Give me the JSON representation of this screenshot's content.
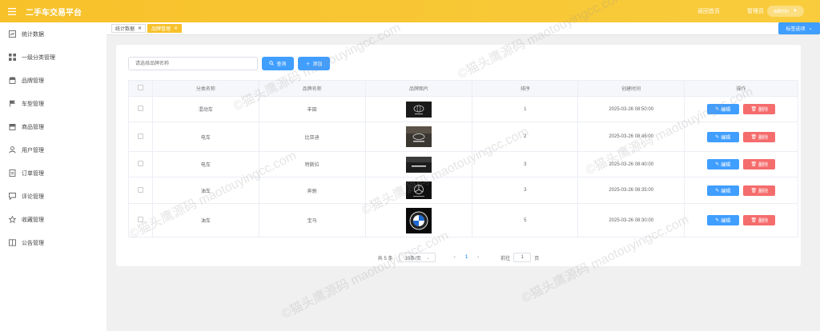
{
  "header": {
    "title": "二手车交易平台",
    "home_link": "返回首页",
    "user_role": "管理员",
    "username": "admin"
  },
  "sidebar": {
    "items": [
      {
        "label": "统计数据",
        "icon": "chart-icon"
      },
      {
        "label": "一级分类管理",
        "icon": "grid-icon"
      },
      {
        "label": "品牌管理",
        "icon": "store-icon"
      },
      {
        "label": "车型管理",
        "icon": "flag-icon"
      },
      {
        "label": "商品管理",
        "icon": "goods-icon"
      },
      {
        "label": "用户管理",
        "icon": "user-icon"
      },
      {
        "label": "订单管理",
        "icon": "document-icon"
      },
      {
        "label": "评论管理",
        "icon": "comment-icon"
      },
      {
        "label": "收藏管理",
        "icon": "star-icon"
      },
      {
        "label": "公告管理",
        "icon": "book-icon"
      }
    ]
  },
  "tabs": [
    {
      "label": "统计数据",
      "active": false
    },
    {
      "label": "品牌管理",
      "active": true
    }
  ],
  "tab_options_label": "标签选项",
  "search": {
    "placeholder": "请选择品牌名称",
    "query_label": "查询",
    "add_label": "添加"
  },
  "table": {
    "headers": [
      "分类名称",
      "品牌名称",
      "品牌图片",
      "排序",
      "创建时间",
      "操作"
    ],
    "edit_label": "编辑",
    "delete_label": "删除",
    "rows": [
      {
        "category": "混动车",
        "brand": "丰田",
        "image": "toyota-logo",
        "sort": "1",
        "created": "2025-03-26 08:50:00"
      },
      {
        "category": "电车",
        "brand": "比亚迪",
        "image": "byd-logo",
        "sort": "2",
        "created": "2025-03-26 08:45:00"
      },
      {
        "category": "电车",
        "brand": "特斯拉",
        "image": "tesla-logo",
        "sort": "3",
        "created": "2025-03-26 08:40:00"
      },
      {
        "category": "油车",
        "brand": "奔驰",
        "image": "mercedes-logo",
        "sort": "3",
        "created": "2025-03-26 08:35:00"
      },
      {
        "category": "油车",
        "brand": "宝马",
        "image": "bmw-logo",
        "sort": "5",
        "created": "2025-03-26 08:30:00"
      }
    ]
  },
  "pagination": {
    "total": "共 5 条",
    "page_size": "10条/页",
    "current_page": "1",
    "goto_label": "前往",
    "goto_value": "1",
    "page_suffix": "页"
  },
  "watermark_text": "©猫头鹰源码 maotouyingcc.com",
  "colors": {
    "header": "#f7c12a",
    "primary": "#409eff",
    "danger": "#f56c6c"
  }
}
